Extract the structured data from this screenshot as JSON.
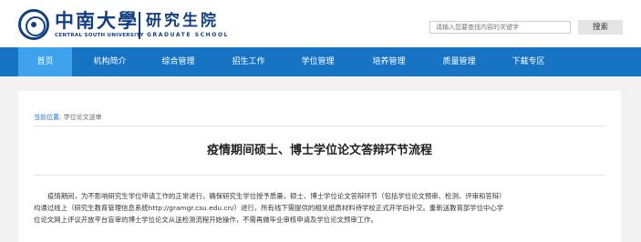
{
  "header": {
    "logo": {
      "name_cn": "中南大學",
      "name_en": "CENTRAL SOUTH UNIVERSITY",
      "school_cn": "研究生院",
      "school_en": "GRADUATE SCHOOL"
    },
    "search": {
      "placeholder": "请输入您要查找内容的关键字",
      "button_label": "搜索"
    }
  },
  "nav": {
    "items": [
      {
        "label": "首页",
        "active": true
      },
      {
        "label": "机构简介"
      },
      {
        "label": "综合管理"
      },
      {
        "label": "招生工作"
      },
      {
        "label": "学位管理"
      },
      {
        "label": "培养管理"
      },
      {
        "label": "质量管理"
      },
      {
        "label": "下载专区"
      }
    ]
  },
  "breadcrumb": {
    "label": "当前位置:",
    "current": "学位论文送审"
  },
  "article": {
    "title": "疫情期间硕士、博士学位论文答辩环节流程",
    "lines": [
      "疫情期间，为不影响研究生学位申请工作的正常进行，确保研究生学位授予质量，硕士、博士学位论文答辩环节（包括学位论文预审、检测、评审和答辩）",
      "均通过线上（研究生教育管理信息系统http://gramgr.csu.edu.cn/）进行，所有线下需提供的相关纸质材料待学校正式开学后补交。重新送教育部学位中心学",
      "位论文网上评议开放平台盲审的博士学位论文从送检测流程开始操作，不需再做毕业审核申请及学位论文预审工作。"
    ]
  }
}
